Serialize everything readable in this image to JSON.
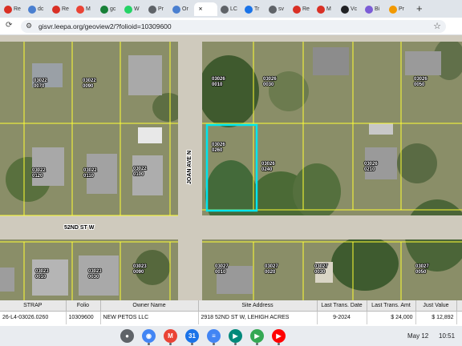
{
  "tabs": [
    {
      "label": "Re",
      "icon": "realtor-icon",
      "color": "#d93025"
    },
    {
      "label": "dc",
      "icon": "globe-icon",
      "color": "#4a7fd0"
    },
    {
      "label": "Re",
      "icon": "realtor-icon",
      "color": "#d93025"
    },
    {
      "label": "M",
      "icon": "gmail-icon",
      "color": "#ea4335"
    },
    {
      "label": "gc",
      "icon": "sheets-icon",
      "color": "#188038"
    },
    {
      "label": "W",
      "icon": "whatsapp-icon",
      "color": "#25d366"
    },
    {
      "label": "Pr",
      "icon": "document-icon",
      "color": "#5f6368"
    },
    {
      "label": "Or",
      "icon": "globe-icon",
      "color": "#4a7fd0"
    },
    {
      "label": "",
      "icon": "close-icon",
      "color": "#ffffff",
      "active": true
    },
    {
      "label": "LC",
      "icon": "lock-icon",
      "color": "#5f6368"
    },
    {
      "label": "Tr",
      "icon": "document-icon",
      "color": "#1a73e8"
    },
    {
      "label": "sv",
      "icon": "globe-icon",
      "color": "#5f6368"
    },
    {
      "label": "Re",
      "icon": "realtor-icon",
      "color": "#d93025"
    },
    {
      "label": "M",
      "icon": "realtor-icon",
      "color": "#d93025"
    },
    {
      "label": "Vc",
      "icon": "globe-icon",
      "color": "#202124"
    },
    {
      "label": "Bi",
      "icon": "globe-icon",
      "color": "#7b5cd6"
    },
    {
      "label": "Pr",
      "icon": "document-icon",
      "color": "#f29900"
    }
  ],
  "new_tab": "+",
  "address_bar": {
    "url": "gisvr.leepa.org/geoview2/?folioid=10309600",
    "site_info_icon": "tune-icon",
    "bookmark_icon": "star-icon"
  },
  "map": {
    "street_labels": {
      "vertical": "JOAN AVE N",
      "horizontal": "52ND ST W"
    },
    "parcel_labels": [
      {
        "line1": "03022",
        "line2": "0070"
      },
      {
        "line1": "03022",
        "line2": "0090"
      },
      {
        "line1": "03026",
        "line2": "0010"
      },
      {
        "line1": "03026",
        "line2": "0030"
      },
      {
        "line1": "03026",
        "line2": "0050"
      },
      {
        "line1": "03022",
        "line2": "0120"
      },
      {
        "line1": "03022",
        "line2": "0110"
      },
      {
        "line1": "03022",
        "line2": "0100"
      },
      {
        "line1": "03026",
        "line2": "0260"
      },
      {
        "line1": "03026",
        "line2": "0240"
      },
      {
        "line1": "03026",
        "line2": "0210"
      },
      {
        "line1": "03023",
        "line2": "0010"
      },
      {
        "line1": "03023",
        "line2": "0030"
      },
      {
        "line1": "03023",
        "line2": "0090"
      },
      {
        "line1": "03027",
        "line2": "0010"
      },
      {
        "line1": "03027",
        "line2": "0020"
      },
      {
        "line1": "03027",
        "line2": "0030"
      },
      {
        "line1": "03027",
        "line2": "0050"
      }
    ],
    "colors": {
      "parcel_line": "#ffff33",
      "selected": "#00e5ee",
      "road": "#c9c4b8"
    }
  },
  "table": {
    "columns": [
      "STRAP",
      "Folio",
      "Owner Name",
      "Site Address",
      "Last Trans. Date",
      "Last Trans. Amt",
      "Just Value",
      "T"
    ],
    "rows": [
      [
        "26-L4-03026.0260",
        "10309600",
        "NEW PETOS LLC",
        "2918 52ND ST W, LEHIGH ACRES",
        "9-2024",
        "$ 24,000",
        "$ 12,892",
        ""
      ]
    ]
  },
  "taskbar": {
    "apps": [
      {
        "name": "launcher-icon",
        "color": "#5f6368",
        "glyph": "●"
      },
      {
        "name": "chrome-icon",
        "color": "#4285f4",
        "glyph": "◉"
      },
      {
        "name": "gmail-icon",
        "color": "#ea4335",
        "glyph": "M"
      },
      {
        "name": "calendar-icon",
        "color": "#1a73e8",
        "glyph": "31"
      },
      {
        "name": "docs-icon",
        "color": "#4285f4",
        "glyph": "≡"
      },
      {
        "name": "meet-icon",
        "color": "#00897b",
        "glyph": "▶"
      },
      {
        "name": "play-store-icon",
        "color": "#34a853",
        "glyph": "▶"
      },
      {
        "name": "youtube-icon",
        "color": "#ff0000",
        "glyph": "▶"
      }
    ],
    "date": "May 12",
    "time": "10:51"
  }
}
